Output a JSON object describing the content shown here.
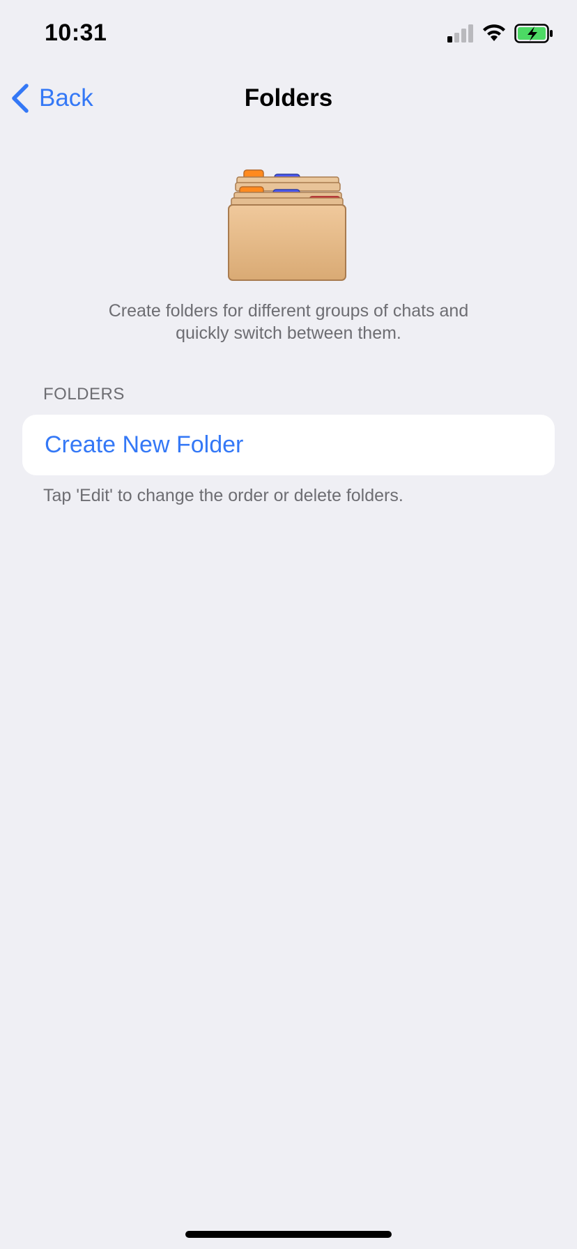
{
  "status_bar": {
    "time": "10:31",
    "icons": [
      "signal-icon",
      "wifi-icon",
      "battery-charging-icon"
    ],
    "battery_color": "#4cd964"
  },
  "nav": {
    "back_label": "Back",
    "title": "Folders"
  },
  "intro": {
    "illustration": "folders-illustration-icon",
    "description_line1": "Create folders for different groups of chats and",
    "description_line2": "quickly switch between them."
  },
  "folders_section": {
    "header": "FOLDERS",
    "create_label": "Create New Folder",
    "hint": "Tap 'Edit' to change the order or delete folders."
  },
  "colors": {
    "accent": "#3478f6",
    "background": "#efeff4",
    "secondary_text": "#6d6d72"
  }
}
